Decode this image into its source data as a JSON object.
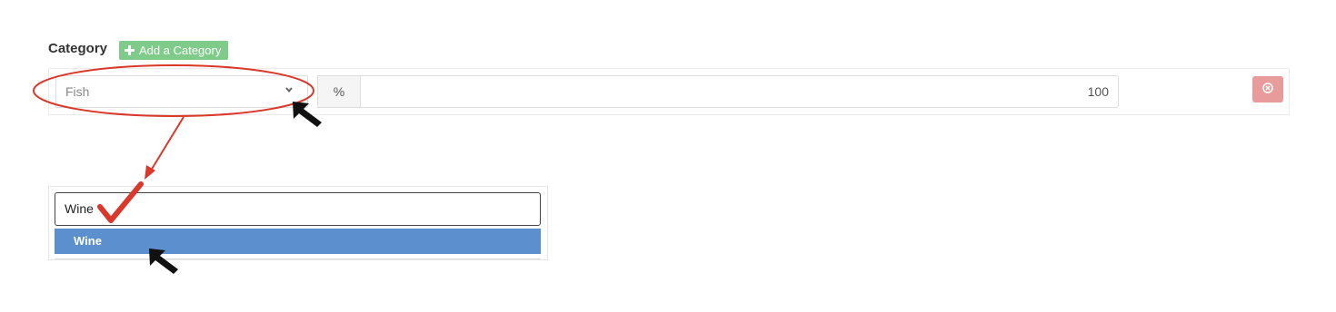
{
  "form": {
    "category_label": "Category",
    "add_category_label": "Add a Category",
    "category_select": {
      "value": "Fish"
    },
    "percent_addon": "%",
    "percent_value": "100"
  },
  "dropdown": {
    "search_value": "Wine",
    "options": [
      {
        "label": "Wine",
        "highlighted": true
      }
    ]
  },
  "colors": {
    "add_button": "#7fcc8a",
    "remove_button": "#e89b9b",
    "highlight": "#5b8fcd",
    "annotation_red": "#d9382a"
  },
  "icons": {
    "add": "plus-icon",
    "select_arrow": "chevron-down-icon",
    "remove": "circle-x-icon",
    "annotation_cursor": "arrow-cursor-icon",
    "annotation_check": "checkmark-icon"
  }
}
